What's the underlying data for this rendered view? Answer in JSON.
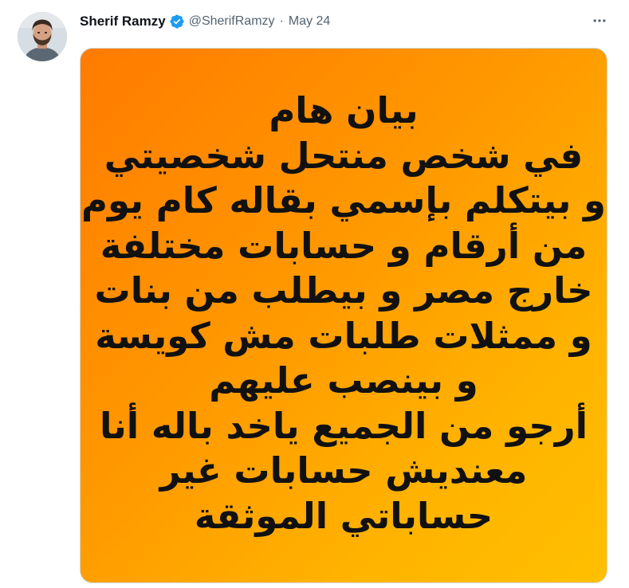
{
  "tweet": {
    "author": {
      "display_name": "Sherif Ramzy",
      "handle": "@SherifRamzy",
      "verified": true,
      "avatar_icon": "profile-photo"
    },
    "separator": "·",
    "date": "May 24",
    "more_icon": "more-horizontal-icon",
    "image": {
      "lines": [
        "بيان هام",
        "في شخص منتحل شخصيتي",
        "و بيتكلم بإسمي بقاله كام يوم",
        "من أرقام و حسابات مختلفة",
        "خارج مصر و بيطلب من بنات",
        "و ممثلات طلبات مش كويسة",
        "و بينصب عليهم",
        "أرجو من الجميع ياخد باله أنا",
        "معنديش حسابات غير",
        "حساباتي الموثقة"
      ]
    }
  },
  "colors": {
    "verified_badge": "#1d9bf0",
    "gradient_start": "#ff7b00",
    "gradient_end": "#ffc000",
    "name_text": "#0f1419",
    "secondary_text": "#536471"
  }
}
